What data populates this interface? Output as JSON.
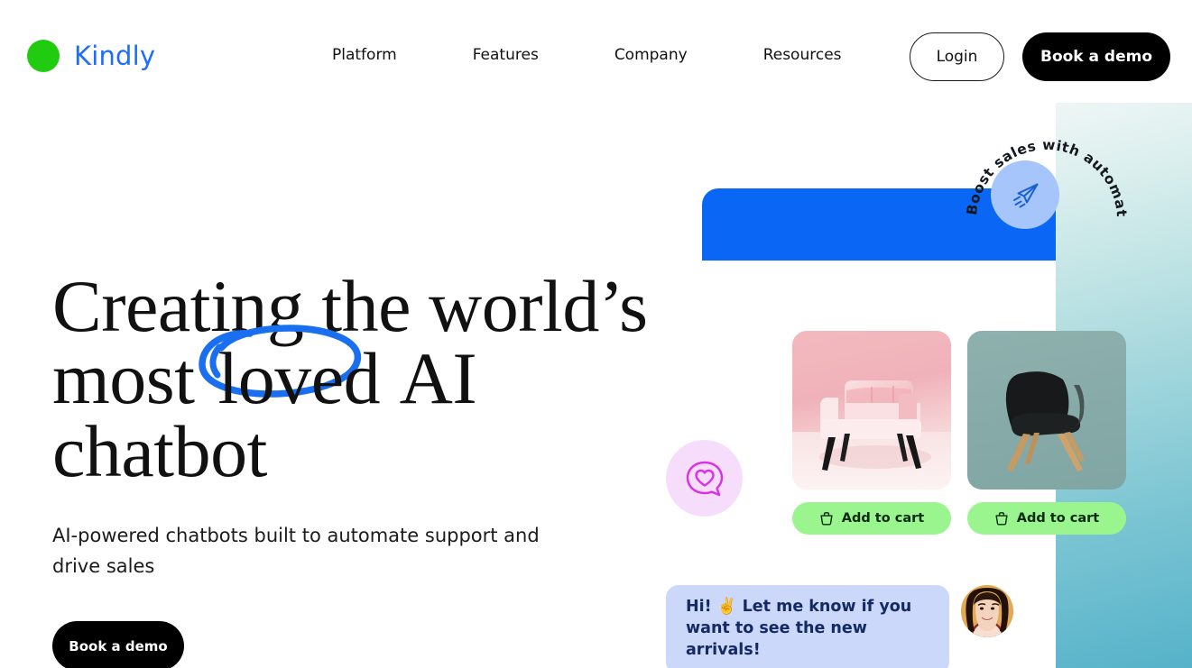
{
  "brand": {
    "name": "Kindly",
    "logo_icon": "green-circle-logo",
    "logo_color": "#21cc10",
    "name_color": "#1f6dff"
  },
  "nav": {
    "items": [
      {
        "label": "Platform"
      },
      {
        "label": "Features"
      },
      {
        "label": "Company"
      },
      {
        "label": "Resources"
      }
    ],
    "login_label": "Login",
    "demo_label": "Book a demo"
  },
  "hero": {
    "headline_line1": "Creating the world’s",
    "headline_line2_pre": "most ",
    "headline_line2_marked": "loved",
    "headline_line2_post": " AI",
    "headline_line3": "chatbot",
    "highlight_color": "#1f6dff",
    "subhead": "AI-powered chatbots built to automate support and drive sales",
    "cta_label": "Book a demo"
  },
  "illustration": {
    "badge_text": "Boost sales with automation",
    "badge_icon": "paper-plane-icon",
    "badge_circle_color": "#a6c5fb",
    "chat_bar_color": "#0a66f5",
    "heart_icon": "heart-chat-bubble-icon",
    "heart_badge_color": "#f6ddfb",
    "products": [
      {
        "name": "pink-armchair",
        "cart_label": "Add to cart",
        "cart_icon": "shopping-basket-icon",
        "cart_color": "#9bf58f"
      },
      {
        "name": "black-dining-chair",
        "cart_label": "Add to cart",
        "cart_icon": "shopping-basket-icon",
        "cart_color": "#9bf58f"
      }
    ],
    "chat_message": "Hi! ✌️ Let me know if you want to see the new arrivals!",
    "chat_bubble_color": "#cbd8fa",
    "avatar_alt": "support-agent-avatar"
  }
}
